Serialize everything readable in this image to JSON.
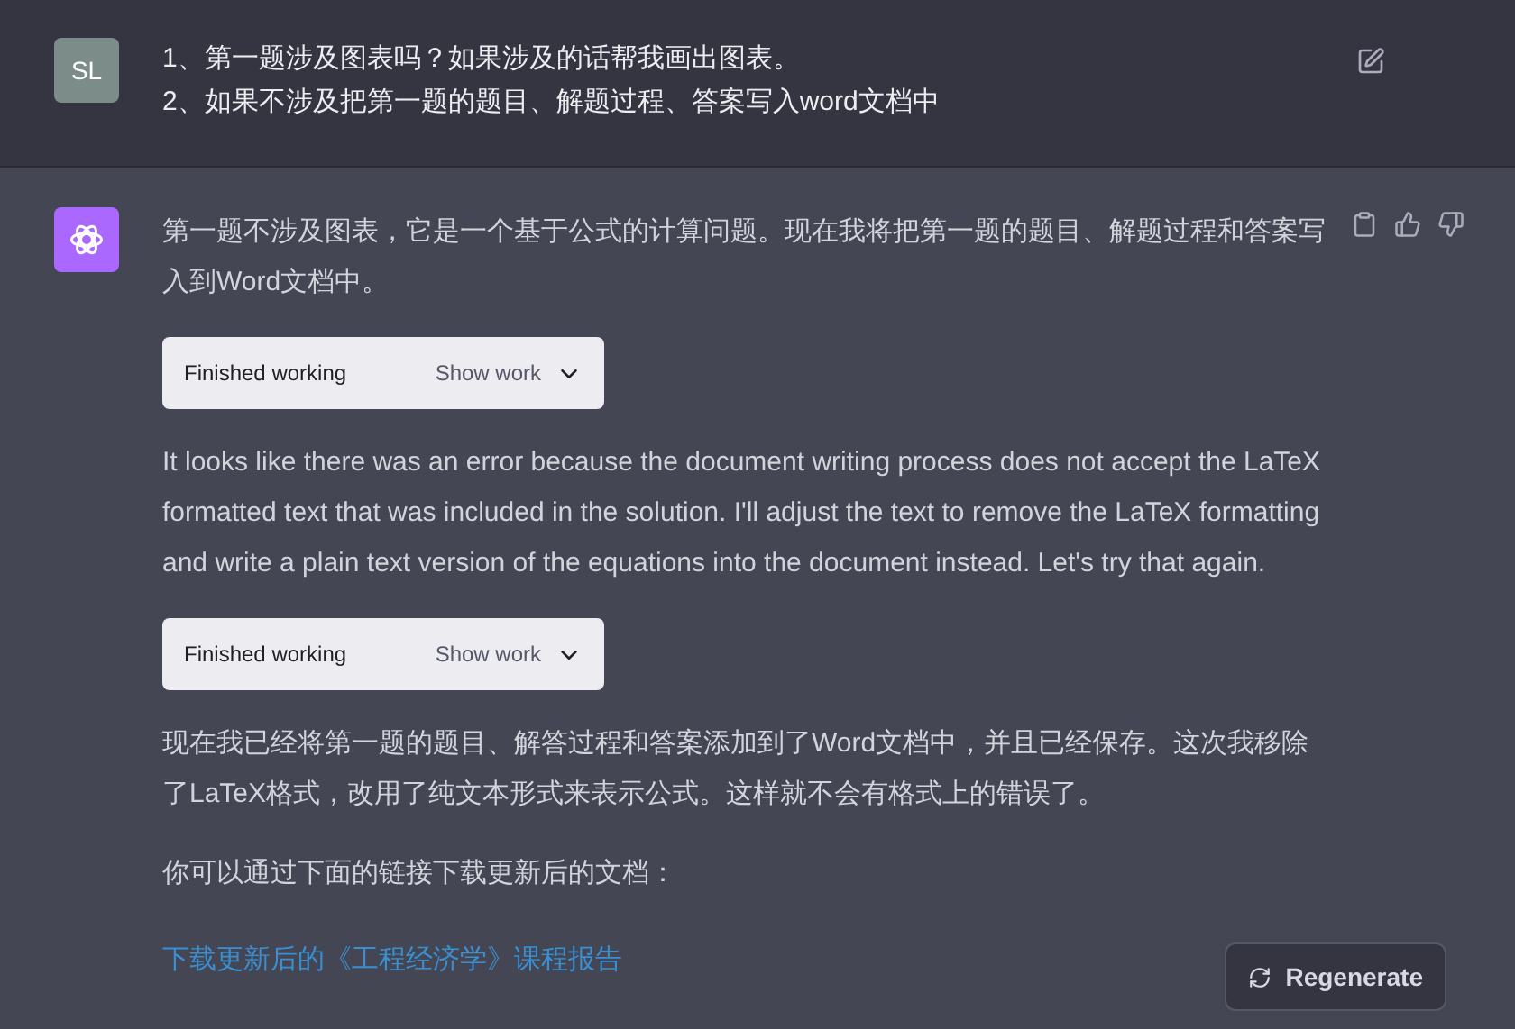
{
  "user_message": {
    "avatar": "SL",
    "lines": [
      "1、第一题涉及图表吗？如果涉及的话帮我画出图表。",
      "2、如果不涉及把第一题的题目、解题过程、答案写入word文档中"
    ]
  },
  "assistant_message": {
    "blocks": [
      {
        "kind": "paragraph",
        "text": "第一题不涉及图表，它是一个基于公式的计算问题。现在我将把第一题的题目、解题过程和答案写入到Word文档中。"
      },
      {
        "kind": "tool",
        "status": "Finished working",
        "action": "Show work",
        "expanded": false
      },
      {
        "kind": "paragraph",
        "text": "It looks like there was an error because the document writing process does not accept the LaTeX formatted text that was included in the solution. I'll adjust the text to remove the LaTeX formatting and write a plain text version of the equations into the document instead. Let's try that again."
      },
      {
        "kind": "tool",
        "status": "Finished working",
        "action": "Show work",
        "expanded": false
      },
      {
        "kind": "paragraph",
        "text": "现在我已经将第一题的题目、解答过程和答案添加到了Word文档中，并且已经保存。这次我移除了LaTeX格式，改用了纯文本形式来表示公式。这样就不会有格式上的错误了。"
      },
      {
        "kind": "paragraph",
        "text": "你可以通过下面的链接下载更新后的文档："
      },
      {
        "kind": "link",
        "text": "下载更新后的《工程经济学》课程报告"
      }
    ]
  },
  "regenerate_button": "Regenerate"
}
